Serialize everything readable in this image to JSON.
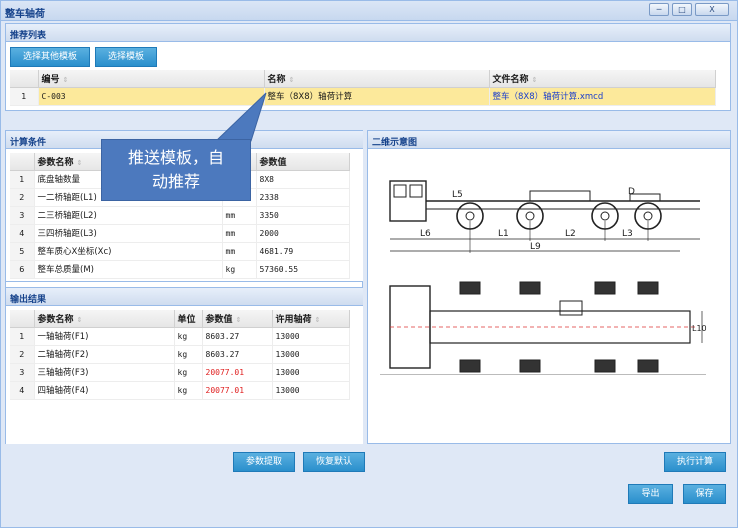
{
  "window": {
    "title": "整车轴荷",
    "minimize": "─",
    "maximize": "□",
    "close": "X"
  },
  "recommend": {
    "header": "推荐列表",
    "btn_other": "选择其他模板",
    "btn_select": "选择模板",
    "columns": [
      "编号",
      "名称",
      "文件名称"
    ],
    "rows": [
      {
        "idx": "1",
        "code": "C-003",
        "name": "整车（8X8）轴荷计算",
        "file": "整车（8X8）轴荷计算.xmcd"
      }
    ]
  },
  "calc": {
    "header": "计算条件",
    "columns": [
      "参数名称",
      "单位",
      "参数值"
    ],
    "rows": [
      {
        "idx": "1",
        "name": "底盘轴数量",
        "unit": "",
        "value": "8X8"
      },
      {
        "idx": "2",
        "name": "一二桥轴距(L1)",
        "unit": "",
        "value": "2338"
      },
      {
        "idx": "3",
        "name": "二三桥轴距(L2)",
        "unit": "mm",
        "value": "3350"
      },
      {
        "idx": "4",
        "name": "三四桥轴距(L3)",
        "unit": "mm",
        "value": "2000"
      },
      {
        "idx": "5",
        "name": "整车质心X坐标(Xc)",
        "unit": "mm",
        "value": "4681.79"
      },
      {
        "idx": "6",
        "name": "整车总质量(M)",
        "unit": "kg",
        "value": "57360.55"
      }
    ]
  },
  "output": {
    "header": "输出结果",
    "columns": [
      "参数名称",
      "单位",
      "参数值",
      "许用轴荷"
    ],
    "rows": [
      {
        "idx": "1",
        "name": "一轴轴荷(F1)",
        "unit": "kg",
        "value": "8603.27",
        "allow": "13000"
      },
      {
        "idx": "2",
        "name": "二轴轴荷(F2)",
        "unit": "kg",
        "value": "8603.27",
        "allow": "13000"
      },
      {
        "idx": "3",
        "name": "三轴轴荷(F3)",
        "unit": "kg",
        "value": "20077.01",
        "allow": "13000"
      },
      {
        "idx": "4",
        "name": "四轴轴荷(F4)",
        "unit": "kg",
        "value": "20077.01",
        "allow": "13000"
      }
    ]
  },
  "diagram": {
    "header": "二维示意图",
    "dims": [
      "L5",
      "L6",
      "L1",
      "L2",
      "L3",
      "L9",
      "D",
      "L10"
    ]
  },
  "callout": {
    "line1": "推送模板，自",
    "line2": "动推荐"
  },
  "buttons": {
    "extract": "参数提取",
    "reset": "恢复默认",
    "execute": "执行计算",
    "export": "导出",
    "save": "保存"
  },
  "colors": {
    "accent": "#2a8fcc",
    "selected_row": "#fce99b",
    "header_text": "#15428b",
    "over_limit": "#e02020"
  }
}
